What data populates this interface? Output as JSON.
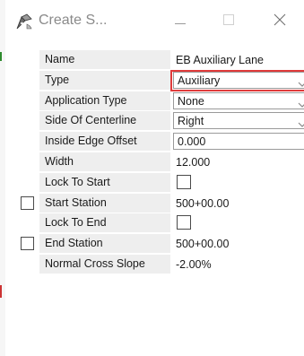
{
  "window": {
    "title": "Create S...",
    "icons": {
      "app": "pen-tool-icon",
      "minimize": "minimize-icon",
      "maximize": "maximize-icon",
      "close": "close-icon"
    }
  },
  "colors": {
    "highlight": "#e03b3b",
    "label_bg": "#eeeeee",
    "title_text": "#8a8a8a"
  },
  "properties": [
    {
      "label": "Name",
      "value": "EB Auxiliary Lane",
      "kind": "text"
    },
    {
      "label": "Type",
      "value": "Auxiliary",
      "kind": "select",
      "highlighted": true
    },
    {
      "label": "Application Type",
      "value": "None",
      "kind": "select"
    },
    {
      "label": "Side Of Centerline",
      "value": "Right",
      "kind": "select"
    },
    {
      "label": "Inside Edge Offset",
      "value": "0.000",
      "kind": "input"
    },
    {
      "label": "Width",
      "value": "12.000",
      "kind": "text"
    },
    {
      "label": "Lock To Start",
      "value": "",
      "kind": "checkbox",
      "checked": false
    },
    {
      "label": "Start Station",
      "value": "500+00.00",
      "kind": "text",
      "row_checkbox": true,
      "row_checked": false
    },
    {
      "label": "Lock To End",
      "value": "",
      "kind": "checkbox",
      "checked": false
    },
    {
      "label": "End Station",
      "value": "500+00.00",
      "kind": "text",
      "row_checkbox": true,
      "row_checked": false
    },
    {
      "label": "Normal Cross Slope",
      "value": "-2.00%",
      "kind": "text"
    }
  ]
}
